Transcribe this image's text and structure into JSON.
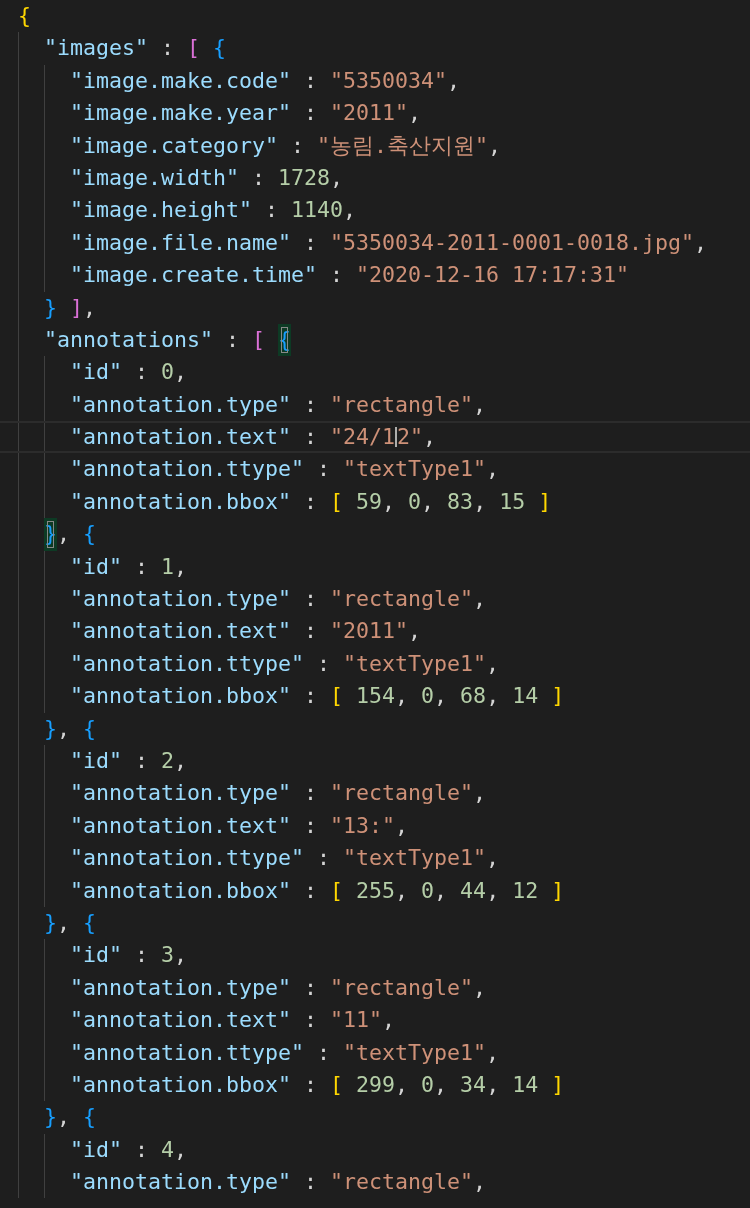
{
  "editor": {
    "lines": [
      {
        "current": false,
        "tokens": [
          {
            "kind": "bracket",
            "text": "{",
            "color": "#ffd700",
            "matched": false
          }
        ],
        "children": [
          {
            "current": false,
            "tokens": [
              {
                "kind": "key",
                "text": "\"images\""
              },
              {
                "kind": "punct",
                "text": " : "
              },
              {
                "kind": "bracket",
                "text": "[ ",
                "color": "#da70d6",
                "matched": false
              },
              {
                "kind": "bracket",
                "text": "{",
                "color": "#179fff",
                "matched": false
              }
            ],
            "children": [
              {
                "current": false,
                "tokens": [
                  {
                    "kind": "key",
                    "text": "\"image.make.code\""
                  },
                  {
                    "kind": "punct",
                    "text": " : "
                  },
                  {
                    "kind": "string",
                    "text": "\"5350034\""
                  },
                  {
                    "kind": "punct",
                    "text": ","
                  }
                ]
              },
              {
                "current": false,
                "tokens": [
                  {
                    "kind": "key",
                    "text": "\"image.make.year\""
                  },
                  {
                    "kind": "punct",
                    "text": " : "
                  },
                  {
                    "kind": "string",
                    "text": "\"2011\""
                  },
                  {
                    "kind": "punct",
                    "text": ","
                  }
                ]
              },
              {
                "current": false,
                "tokens": [
                  {
                    "kind": "key",
                    "text": "\"image.category\""
                  },
                  {
                    "kind": "punct",
                    "text": " : "
                  },
                  {
                    "kind": "string",
                    "text": "\"농림.축산지원\""
                  },
                  {
                    "kind": "punct",
                    "text": ","
                  }
                ]
              },
              {
                "current": false,
                "tokens": [
                  {
                    "kind": "key",
                    "text": "\"image.width\""
                  },
                  {
                    "kind": "punct",
                    "text": " : "
                  },
                  {
                    "kind": "number",
                    "text": "1728"
                  },
                  {
                    "kind": "punct",
                    "text": ","
                  }
                ]
              },
              {
                "current": false,
                "tokens": [
                  {
                    "kind": "key",
                    "text": "\"image.height\""
                  },
                  {
                    "kind": "punct",
                    "text": " : "
                  },
                  {
                    "kind": "number",
                    "text": "1140"
                  },
                  {
                    "kind": "punct",
                    "text": ","
                  }
                ]
              },
              {
                "current": false,
                "tokens": [
                  {
                    "kind": "key",
                    "text": "\"image.file.name\""
                  },
                  {
                    "kind": "punct",
                    "text": " : "
                  },
                  {
                    "kind": "string",
                    "text": "\"5350034-2011-0001-0018.jpg\""
                  },
                  {
                    "kind": "punct",
                    "text": ","
                  }
                ]
              },
              {
                "current": false,
                "tokens": [
                  {
                    "kind": "key",
                    "text": "\"image.create.time\""
                  },
                  {
                    "kind": "punct",
                    "text": " : "
                  },
                  {
                    "kind": "string",
                    "text": "\"2020-12-16 17:17:31\""
                  }
                ]
              }
            ]
          },
          {
            "current": false,
            "tokens": [
              {
                "kind": "bracket",
                "text": "} ",
                "color": "#179fff",
                "matched": false
              },
              {
                "kind": "bracket",
                "text": "]",
                "color": "#da70d6",
                "matched": false
              },
              {
                "kind": "punct",
                "text": ","
              }
            ]
          },
          {
            "current": false,
            "tokens": [
              {
                "kind": "key",
                "text": "\"annotations\""
              },
              {
                "kind": "punct",
                "text": " : "
              },
              {
                "kind": "bracket",
                "text": "[ ",
                "color": "#da70d6",
                "matched": false
              },
              {
                "kind": "bracket",
                "text": "{",
                "color": "#179fff",
                "matched": true
              }
            ],
            "children": [
              {
                "current": false,
                "tokens": [
                  {
                    "kind": "key",
                    "text": "\"id\""
                  },
                  {
                    "kind": "punct",
                    "text": " : "
                  },
                  {
                    "kind": "number",
                    "text": "0"
                  },
                  {
                    "kind": "punct",
                    "text": ","
                  }
                ]
              },
              {
                "current": false,
                "tokens": [
                  {
                    "kind": "key",
                    "text": "\"annotation.type\""
                  },
                  {
                    "kind": "punct",
                    "text": " : "
                  },
                  {
                    "kind": "string",
                    "text": "\"rectangle\""
                  },
                  {
                    "kind": "punct",
                    "text": ","
                  }
                ]
              },
              {
                "current": true,
                "tokens": [
                  {
                    "kind": "key",
                    "text": "\"annotation.text\""
                  },
                  {
                    "kind": "punct",
                    "text": " : "
                  },
                  {
                    "kind": "string",
                    "text": "\"24/1"
                  },
                  {
                    "kind": "caret"
                  },
                  {
                    "kind": "string",
                    "text": "2\""
                  },
                  {
                    "kind": "punct",
                    "text": ","
                  }
                ]
              },
              {
                "current": false,
                "tokens": [
                  {
                    "kind": "key",
                    "text": "\"annotation.ttype\""
                  },
                  {
                    "kind": "punct",
                    "text": " : "
                  },
                  {
                    "kind": "string",
                    "text": "\"textType1\""
                  },
                  {
                    "kind": "punct",
                    "text": ","
                  }
                ]
              },
              {
                "current": false,
                "tokens": [
                  {
                    "kind": "key",
                    "text": "\"annotation.bbox\""
                  },
                  {
                    "kind": "punct",
                    "text": " : "
                  },
                  {
                    "kind": "bracket",
                    "text": "[ ",
                    "color": "#ffd700",
                    "matched": false
                  },
                  {
                    "kind": "number",
                    "text": "59"
                  },
                  {
                    "kind": "punct",
                    "text": ", "
                  },
                  {
                    "kind": "number",
                    "text": "0"
                  },
                  {
                    "kind": "punct",
                    "text": ", "
                  },
                  {
                    "kind": "number",
                    "text": "83"
                  },
                  {
                    "kind": "punct",
                    "text": ", "
                  },
                  {
                    "kind": "number",
                    "text": "15"
                  },
                  {
                    "kind": "bracket",
                    "text": " ]",
                    "color": "#ffd700",
                    "matched": false
                  }
                ]
              }
            ]
          },
          {
            "current": false,
            "tokens": [
              {
                "kind": "bracket",
                "text": "}",
                "color": "#179fff",
                "matched": true
              },
              {
                "kind": "punct",
                "text": ", "
              },
              {
                "kind": "bracket",
                "text": "{",
                "color": "#179fff",
                "matched": false
              }
            ],
            "children": [
              {
                "current": false,
                "tokens": [
                  {
                    "kind": "key",
                    "text": "\"id\""
                  },
                  {
                    "kind": "punct",
                    "text": " : "
                  },
                  {
                    "kind": "number",
                    "text": "1"
                  },
                  {
                    "kind": "punct",
                    "text": ","
                  }
                ]
              },
              {
                "current": false,
                "tokens": [
                  {
                    "kind": "key",
                    "text": "\"annotation.type\""
                  },
                  {
                    "kind": "punct",
                    "text": " : "
                  },
                  {
                    "kind": "string",
                    "text": "\"rectangle\""
                  },
                  {
                    "kind": "punct",
                    "text": ","
                  }
                ]
              },
              {
                "current": false,
                "tokens": [
                  {
                    "kind": "key",
                    "text": "\"annotation.text\""
                  },
                  {
                    "kind": "punct",
                    "text": " : "
                  },
                  {
                    "kind": "string",
                    "text": "\"2011\""
                  },
                  {
                    "kind": "punct",
                    "text": ","
                  }
                ]
              },
              {
                "current": false,
                "tokens": [
                  {
                    "kind": "key",
                    "text": "\"annotation.ttype\""
                  },
                  {
                    "kind": "punct",
                    "text": " : "
                  },
                  {
                    "kind": "string",
                    "text": "\"textType1\""
                  },
                  {
                    "kind": "punct",
                    "text": ","
                  }
                ]
              },
              {
                "current": false,
                "tokens": [
                  {
                    "kind": "key",
                    "text": "\"annotation.bbox\""
                  },
                  {
                    "kind": "punct",
                    "text": " : "
                  },
                  {
                    "kind": "bracket",
                    "text": "[ ",
                    "color": "#ffd700",
                    "matched": false
                  },
                  {
                    "kind": "number",
                    "text": "154"
                  },
                  {
                    "kind": "punct",
                    "text": ", "
                  },
                  {
                    "kind": "number",
                    "text": "0"
                  },
                  {
                    "kind": "punct",
                    "text": ", "
                  },
                  {
                    "kind": "number",
                    "text": "68"
                  },
                  {
                    "kind": "punct",
                    "text": ", "
                  },
                  {
                    "kind": "number",
                    "text": "14"
                  },
                  {
                    "kind": "bracket",
                    "text": " ]",
                    "color": "#ffd700",
                    "matched": false
                  }
                ]
              }
            ]
          },
          {
            "current": false,
            "tokens": [
              {
                "kind": "bracket",
                "text": "}",
                "color": "#179fff",
                "matched": false
              },
              {
                "kind": "punct",
                "text": ", "
              },
              {
                "kind": "bracket",
                "text": "{",
                "color": "#179fff",
                "matched": false
              }
            ],
            "children": [
              {
                "current": false,
                "tokens": [
                  {
                    "kind": "key",
                    "text": "\"id\""
                  },
                  {
                    "kind": "punct",
                    "text": " : "
                  },
                  {
                    "kind": "number",
                    "text": "2"
                  },
                  {
                    "kind": "punct",
                    "text": ","
                  }
                ]
              },
              {
                "current": false,
                "tokens": [
                  {
                    "kind": "key",
                    "text": "\"annotation.type\""
                  },
                  {
                    "kind": "punct",
                    "text": " : "
                  },
                  {
                    "kind": "string",
                    "text": "\"rectangle\""
                  },
                  {
                    "kind": "punct",
                    "text": ","
                  }
                ]
              },
              {
                "current": false,
                "tokens": [
                  {
                    "kind": "key",
                    "text": "\"annotation.text\""
                  },
                  {
                    "kind": "punct",
                    "text": " : "
                  },
                  {
                    "kind": "string",
                    "text": "\"13:\""
                  },
                  {
                    "kind": "punct",
                    "text": ","
                  }
                ]
              },
              {
                "current": false,
                "tokens": [
                  {
                    "kind": "key",
                    "text": "\"annotation.ttype\""
                  },
                  {
                    "kind": "punct",
                    "text": " : "
                  },
                  {
                    "kind": "string",
                    "text": "\"textType1\""
                  },
                  {
                    "kind": "punct",
                    "text": ","
                  }
                ]
              },
              {
                "current": false,
                "tokens": [
                  {
                    "kind": "key",
                    "text": "\"annotation.bbox\""
                  },
                  {
                    "kind": "punct",
                    "text": " : "
                  },
                  {
                    "kind": "bracket",
                    "text": "[ ",
                    "color": "#ffd700",
                    "matched": false
                  },
                  {
                    "kind": "number",
                    "text": "255"
                  },
                  {
                    "kind": "punct",
                    "text": ", "
                  },
                  {
                    "kind": "number",
                    "text": "0"
                  },
                  {
                    "kind": "punct",
                    "text": ", "
                  },
                  {
                    "kind": "number",
                    "text": "44"
                  },
                  {
                    "kind": "punct",
                    "text": ", "
                  },
                  {
                    "kind": "number",
                    "text": "12"
                  },
                  {
                    "kind": "bracket",
                    "text": " ]",
                    "color": "#ffd700",
                    "matched": false
                  }
                ]
              }
            ]
          },
          {
            "current": false,
            "tokens": [
              {
                "kind": "bracket",
                "text": "}",
                "color": "#179fff",
                "matched": false
              },
              {
                "kind": "punct",
                "text": ", "
              },
              {
                "kind": "bracket",
                "text": "{",
                "color": "#179fff",
                "matched": false
              }
            ],
            "children": [
              {
                "current": false,
                "tokens": [
                  {
                    "kind": "key",
                    "text": "\"id\""
                  },
                  {
                    "kind": "punct",
                    "text": " : "
                  },
                  {
                    "kind": "number",
                    "text": "3"
                  },
                  {
                    "kind": "punct",
                    "text": ","
                  }
                ]
              },
              {
                "current": false,
                "tokens": [
                  {
                    "kind": "key",
                    "text": "\"annotation.type\""
                  },
                  {
                    "kind": "punct",
                    "text": " : "
                  },
                  {
                    "kind": "string",
                    "text": "\"rectangle\""
                  },
                  {
                    "kind": "punct",
                    "text": ","
                  }
                ]
              },
              {
                "current": false,
                "tokens": [
                  {
                    "kind": "key",
                    "text": "\"annotation.text\""
                  },
                  {
                    "kind": "punct",
                    "text": " : "
                  },
                  {
                    "kind": "string",
                    "text": "\"11\""
                  },
                  {
                    "kind": "punct",
                    "text": ","
                  }
                ]
              },
              {
                "current": false,
                "tokens": [
                  {
                    "kind": "key",
                    "text": "\"annotation.ttype\""
                  },
                  {
                    "kind": "punct",
                    "text": " : "
                  },
                  {
                    "kind": "string",
                    "text": "\"textType1\""
                  },
                  {
                    "kind": "punct",
                    "text": ","
                  }
                ]
              },
              {
                "current": false,
                "tokens": [
                  {
                    "kind": "key",
                    "text": "\"annotation.bbox\""
                  },
                  {
                    "kind": "punct",
                    "text": " : "
                  },
                  {
                    "kind": "bracket",
                    "text": "[ ",
                    "color": "#ffd700",
                    "matched": false
                  },
                  {
                    "kind": "number",
                    "text": "299"
                  },
                  {
                    "kind": "punct",
                    "text": ", "
                  },
                  {
                    "kind": "number",
                    "text": "0"
                  },
                  {
                    "kind": "punct",
                    "text": ", "
                  },
                  {
                    "kind": "number",
                    "text": "34"
                  },
                  {
                    "kind": "punct",
                    "text": ", "
                  },
                  {
                    "kind": "number",
                    "text": "14"
                  },
                  {
                    "kind": "bracket",
                    "text": " ]",
                    "color": "#ffd700",
                    "matched": false
                  }
                ]
              }
            ]
          },
          {
            "current": false,
            "tokens": [
              {
                "kind": "bracket",
                "text": "}",
                "color": "#179fff",
                "matched": false
              },
              {
                "kind": "punct",
                "text": ", "
              },
              {
                "kind": "bracket",
                "text": "{",
                "color": "#179fff",
                "matched": false
              }
            ],
            "children": [
              {
                "current": false,
                "tokens": [
                  {
                    "kind": "key",
                    "text": "\"id\""
                  },
                  {
                    "kind": "punct",
                    "text": " : "
                  },
                  {
                    "kind": "number",
                    "text": "4"
                  },
                  {
                    "kind": "punct",
                    "text": ","
                  }
                ]
              },
              {
                "current": false,
                "tokens": [
                  {
                    "kind": "key",
                    "text": "\"annotation.type\""
                  },
                  {
                    "kind": "punct",
                    "text": " : "
                  },
                  {
                    "kind": "string",
                    "text": "\"rectangle\""
                  },
                  {
                    "kind": "punct",
                    "text": ","
                  }
                ]
              }
            ]
          }
        ]
      }
    ]
  }
}
